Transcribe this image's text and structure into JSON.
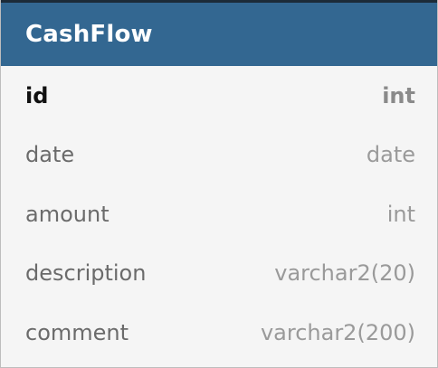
{
  "entity": {
    "name": "CashFlow",
    "columns": [
      {
        "name": "id",
        "type": "int",
        "primary_key": true
      },
      {
        "name": "date",
        "type": "date",
        "primary_key": false
      },
      {
        "name": "amount",
        "type": "int",
        "primary_key": false
      },
      {
        "name": "description",
        "type": "varchar2(20)",
        "primary_key": false
      },
      {
        "name": "comment",
        "type": "varchar2(200)",
        "primary_key": false
      }
    ]
  },
  "colors": {
    "header_bg": "#336791",
    "header_text": "#ffffff",
    "body_bg": "#f5f5f5",
    "pk_text": "#111111",
    "name_text": "#6b6b6b",
    "type_text": "#9a9a9a"
  }
}
